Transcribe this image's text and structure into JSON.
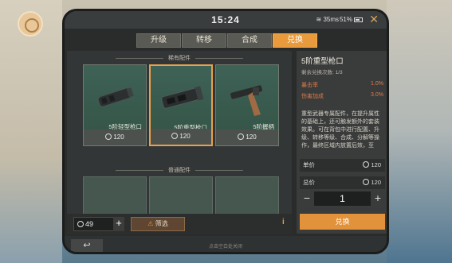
{
  "status": {
    "time": "15:24",
    "signal": "35ms",
    "battery": "51%"
  },
  "tabs": [
    {
      "label": "升级",
      "active": false
    },
    {
      "label": "转移",
      "active": false
    },
    {
      "label": "合成",
      "active": false
    },
    {
      "label": "兑换",
      "active": true
    }
  ],
  "sections": {
    "rare": "稀有配件",
    "common": "普通配件"
  },
  "items": [
    {
      "name": "5阶轻型枪口",
      "price": "120"
    },
    {
      "name": "5阶重型枪口",
      "price": "120"
    },
    {
      "name": "5阶握柄",
      "price": "120"
    }
  ],
  "wallet": {
    "amount": "49"
  },
  "filter_label": "筛选",
  "detail": {
    "title": "5阶重型枪口",
    "remaining": "剩余兑换次数: 1/3",
    "stats": [
      {
        "label": "暴击率",
        "value": "1.0%"
      },
      {
        "label": "伤害加成",
        "value": "3.0%"
      }
    ],
    "description": "重型武器专属配件，在提升属性的基础上，还可触发额外的套装效果。可在背包中进行配置、升级、转移等级、合成、分解等操作，最终区域内放置后效，至",
    "unit_label": "单价",
    "unit_price": "120",
    "total_label": "总价",
    "total_price": "120",
    "quantity": "1",
    "buy_label": "兑换"
  },
  "footer": {
    "text": "点击空白处关闭"
  },
  "colors": {
    "accent": "#e89a3c",
    "card_bg": "#3f6257"
  }
}
